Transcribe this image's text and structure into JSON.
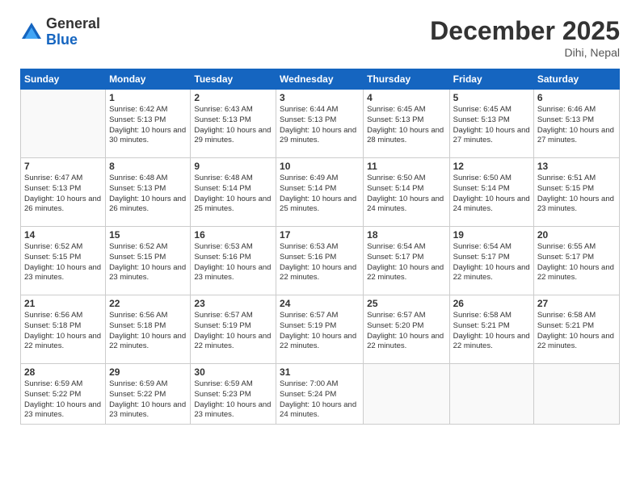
{
  "logo": {
    "general": "General",
    "blue": "Blue"
  },
  "title": "December 2025",
  "location": "Dihi, Nepal",
  "days_of_week": [
    "Sunday",
    "Monday",
    "Tuesday",
    "Wednesday",
    "Thursday",
    "Friday",
    "Saturday"
  ],
  "weeks": [
    [
      {
        "day": "",
        "sunrise": "",
        "sunset": "",
        "daylight": ""
      },
      {
        "day": "1",
        "sunrise": "Sunrise: 6:42 AM",
        "sunset": "Sunset: 5:13 PM",
        "daylight": "Daylight: 10 hours and 30 minutes."
      },
      {
        "day": "2",
        "sunrise": "Sunrise: 6:43 AM",
        "sunset": "Sunset: 5:13 PM",
        "daylight": "Daylight: 10 hours and 29 minutes."
      },
      {
        "day": "3",
        "sunrise": "Sunrise: 6:44 AM",
        "sunset": "Sunset: 5:13 PM",
        "daylight": "Daylight: 10 hours and 29 minutes."
      },
      {
        "day": "4",
        "sunrise": "Sunrise: 6:45 AM",
        "sunset": "Sunset: 5:13 PM",
        "daylight": "Daylight: 10 hours and 28 minutes."
      },
      {
        "day": "5",
        "sunrise": "Sunrise: 6:45 AM",
        "sunset": "Sunset: 5:13 PM",
        "daylight": "Daylight: 10 hours and 27 minutes."
      },
      {
        "day": "6",
        "sunrise": "Sunrise: 6:46 AM",
        "sunset": "Sunset: 5:13 PM",
        "daylight": "Daylight: 10 hours and 27 minutes."
      }
    ],
    [
      {
        "day": "7",
        "sunrise": "Sunrise: 6:47 AM",
        "sunset": "Sunset: 5:13 PM",
        "daylight": "Daylight: 10 hours and 26 minutes."
      },
      {
        "day": "8",
        "sunrise": "Sunrise: 6:48 AM",
        "sunset": "Sunset: 5:13 PM",
        "daylight": "Daylight: 10 hours and 26 minutes."
      },
      {
        "day": "9",
        "sunrise": "Sunrise: 6:48 AM",
        "sunset": "Sunset: 5:14 PM",
        "daylight": "Daylight: 10 hours and 25 minutes."
      },
      {
        "day": "10",
        "sunrise": "Sunrise: 6:49 AM",
        "sunset": "Sunset: 5:14 PM",
        "daylight": "Daylight: 10 hours and 25 minutes."
      },
      {
        "day": "11",
        "sunrise": "Sunrise: 6:50 AM",
        "sunset": "Sunset: 5:14 PM",
        "daylight": "Daylight: 10 hours and 24 minutes."
      },
      {
        "day": "12",
        "sunrise": "Sunrise: 6:50 AM",
        "sunset": "Sunset: 5:14 PM",
        "daylight": "Daylight: 10 hours and 24 minutes."
      },
      {
        "day": "13",
        "sunrise": "Sunrise: 6:51 AM",
        "sunset": "Sunset: 5:15 PM",
        "daylight": "Daylight: 10 hours and 23 minutes."
      }
    ],
    [
      {
        "day": "14",
        "sunrise": "Sunrise: 6:52 AM",
        "sunset": "Sunset: 5:15 PM",
        "daylight": "Daylight: 10 hours and 23 minutes."
      },
      {
        "day": "15",
        "sunrise": "Sunrise: 6:52 AM",
        "sunset": "Sunset: 5:15 PM",
        "daylight": "Daylight: 10 hours and 23 minutes."
      },
      {
        "day": "16",
        "sunrise": "Sunrise: 6:53 AM",
        "sunset": "Sunset: 5:16 PM",
        "daylight": "Daylight: 10 hours and 23 minutes."
      },
      {
        "day": "17",
        "sunrise": "Sunrise: 6:53 AM",
        "sunset": "Sunset: 5:16 PM",
        "daylight": "Daylight: 10 hours and 22 minutes."
      },
      {
        "day": "18",
        "sunrise": "Sunrise: 6:54 AM",
        "sunset": "Sunset: 5:17 PM",
        "daylight": "Daylight: 10 hours and 22 minutes."
      },
      {
        "day": "19",
        "sunrise": "Sunrise: 6:54 AM",
        "sunset": "Sunset: 5:17 PM",
        "daylight": "Daylight: 10 hours and 22 minutes."
      },
      {
        "day": "20",
        "sunrise": "Sunrise: 6:55 AM",
        "sunset": "Sunset: 5:17 PM",
        "daylight": "Daylight: 10 hours and 22 minutes."
      }
    ],
    [
      {
        "day": "21",
        "sunrise": "Sunrise: 6:56 AM",
        "sunset": "Sunset: 5:18 PM",
        "daylight": "Daylight: 10 hours and 22 minutes."
      },
      {
        "day": "22",
        "sunrise": "Sunrise: 6:56 AM",
        "sunset": "Sunset: 5:18 PM",
        "daylight": "Daylight: 10 hours and 22 minutes."
      },
      {
        "day": "23",
        "sunrise": "Sunrise: 6:57 AM",
        "sunset": "Sunset: 5:19 PM",
        "daylight": "Daylight: 10 hours and 22 minutes."
      },
      {
        "day": "24",
        "sunrise": "Sunrise: 6:57 AM",
        "sunset": "Sunset: 5:19 PM",
        "daylight": "Daylight: 10 hours and 22 minutes."
      },
      {
        "day": "25",
        "sunrise": "Sunrise: 6:57 AM",
        "sunset": "Sunset: 5:20 PM",
        "daylight": "Daylight: 10 hours and 22 minutes."
      },
      {
        "day": "26",
        "sunrise": "Sunrise: 6:58 AM",
        "sunset": "Sunset: 5:21 PM",
        "daylight": "Daylight: 10 hours and 22 minutes."
      },
      {
        "day": "27",
        "sunrise": "Sunrise: 6:58 AM",
        "sunset": "Sunset: 5:21 PM",
        "daylight": "Daylight: 10 hours and 22 minutes."
      }
    ],
    [
      {
        "day": "28",
        "sunrise": "Sunrise: 6:59 AM",
        "sunset": "Sunset: 5:22 PM",
        "daylight": "Daylight: 10 hours and 23 minutes."
      },
      {
        "day": "29",
        "sunrise": "Sunrise: 6:59 AM",
        "sunset": "Sunset: 5:22 PM",
        "daylight": "Daylight: 10 hours and 23 minutes."
      },
      {
        "day": "30",
        "sunrise": "Sunrise: 6:59 AM",
        "sunset": "Sunset: 5:23 PM",
        "daylight": "Daylight: 10 hours and 23 minutes."
      },
      {
        "day": "31",
        "sunrise": "Sunrise: 7:00 AM",
        "sunset": "Sunset: 5:24 PM",
        "daylight": "Daylight: 10 hours and 24 minutes."
      },
      {
        "day": "",
        "sunrise": "",
        "sunset": "",
        "daylight": ""
      },
      {
        "day": "",
        "sunrise": "",
        "sunset": "",
        "daylight": ""
      },
      {
        "day": "",
        "sunrise": "",
        "sunset": "",
        "daylight": ""
      }
    ]
  ]
}
